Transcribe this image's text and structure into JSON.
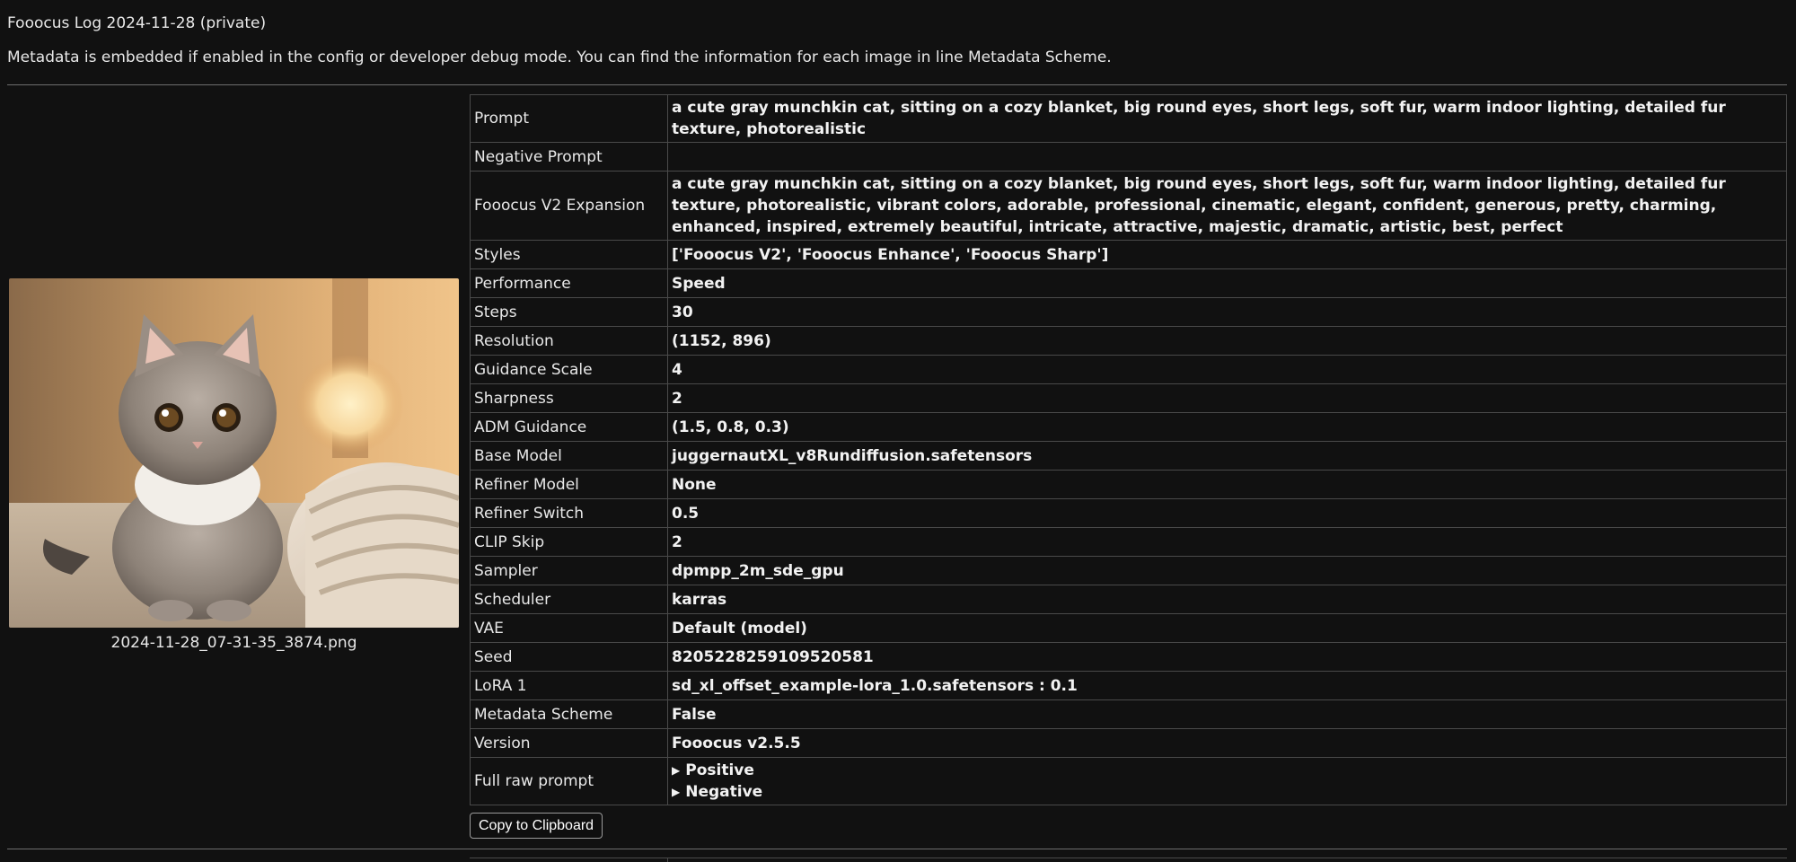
{
  "header": {
    "title": "Fooocus Log 2024-11-28 (private)",
    "description": "Metadata is embedded if enabled in the config or developer debug mode. You can find the information for each image in line Metadata Scheme."
  },
  "entry": {
    "image_alt": "gray munchkin cat on blanket",
    "filename": "2024-11-28_07-31-35_3874.png",
    "rows": [
      {
        "key": "Prompt",
        "value": "a cute gray munchkin cat, sitting on a cozy blanket, big round eyes, short legs, soft fur, warm indoor lighting, detailed fur texture, photorealistic"
      },
      {
        "key": "Negative Prompt",
        "value": ""
      },
      {
        "key": "Fooocus V2 Expansion",
        "value": "a cute gray munchkin cat, sitting on a cozy blanket, big round eyes, short legs, soft fur, warm indoor lighting, detailed fur texture, photorealistic, vibrant colors, adorable, professional, cinematic, elegant, confident, generous, pretty, charming, enhanced, inspired, extremely beautiful, intricate, attractive, majestic, dramatic, artistic, best, perfect"
      },
      {
        "key": "Styles",
        "value": "['Fooocus V2', 'Fooocus Enhance', 'Fooocus Sharp']"
      },
      {
        "key": "Performance",
        "value": "Speed"
      },
      {
        "key": "Steps",
        "value": "30"
      },
      {
        "key": "Resolution",
        "value": "(1152, 896)"
      },
      {
        "key": "Guidance Scale",
        "value": "4"
      },
      {
        "key": "Sharpness",
        "value": "2"
      },
      {
        "key": "ADM Guidance",
        "value": "(1.5, 0.8, 0.3)"
      },
      {
        "key": "Base Model",
        "value": "juggernautXL_v8Rundiffusion.safetensors"
      },
      {
        "key": "Refiner Model",
        "value": "None"
      },
      {
        "key": "Refiner Switch",
        "value": "0.5"
      },
      {
        "key": "CLIP Skip",
        "value": "2"
      },
      {
        "key": "Sampler",
        "value": "dpmpp_2m_sde_gpu"
      },
      {
        "key": "Scheduler",
        "value": "karras"
      },
      {
        "key": "VAE",
        "value": "Default (model)"
      },
      {
        "key": "Seed",
        "value": "8205228259109520581"
      },
      {
        "key": "LoRA 1",
        "value": "sd_xl_offset_example-lora_1.0.safetensors : 0.1"
      },
      {
        "key": "Metadata Scheme",
        "value": "False"
      },
      {
        "key": "Version",
        "value": "Fooocus v2.5.5"
      }
    ],
    "raw_prompt": {
      "key": "Full raw prompt",
      "positive_label": "Positive",
      "negative_label": "Negative",
      "triangle_icon": "▶"
    },
    "copy_button_label": "Copy to Clipboard"
  },
  "colors": {
    "background": "#111111",
    "border": "#4a4a4a",
    "text": "#e8e8e8"
  }
}
